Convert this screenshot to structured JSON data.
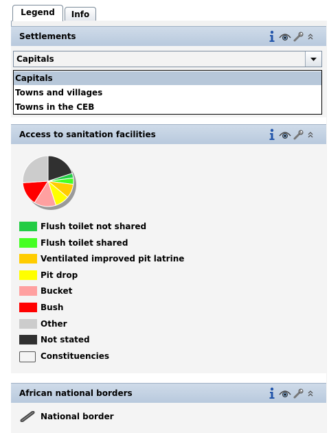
{
  "tabs": [
    {
      "label": "Legend"
    },
    {
      "label": "Info"
    }
  ],
  "settlements": {
    "title": "Settlements",
    "combo_value": "Capitals",
    "options": [
      "Capitals",
      "Towns and villages",
      "Towns in the CEB"
    ]
  },
  "sanitation": {
    "title": "Access to sanitation facilities",
    "pie_slices": [
      {
        "label": "Not stated",
        "value": 20,
        "color": "#303030"
      },
      {
        "label": "Flush toilet not shared",
        "value": 3,
        "color": "#22cc44"
      },
      {
        "label": "Flush toilet shared",
        "value": 4,
        "color": "#44ff22"
      },
      {
        "label": "Ventilated improved pit latrine",
        "value": 9,
        "color": "#ffcc00"
      },
      {
        "label": "Pit drop",
        "value": 9,
        "color": "#ffff00"
      },
      {
        "label": "Bucket",
        "value": 14,
        "color": "#ffa0a0"
      },
      {
        "label": "Bush",
        "value": 15,
        "color": "#ff0000"
      },
      {
        "label": "Other",
        "value": 26,
        "color": "#cccccc"
      }
    ],
    "legend": [
      {
        "label": "Flush toilet not shared",
        "color": "#22cc44"
      },
      {
        "label": "Flush toilet shared",
        "color": "#44ff22"
      },
      {
        "label": "Ventilated improved pit latrine",
        "color": "#ffcc00"
      },
      {
        "label": "Pit drop",
        "color": "#ffff00"
      },
      {
        "label": "Bucket",
        "color": "#ffa0a0"
      },
      {
        "label": "Bush",
        "color": "#ff0000"
      },
      {
        "label": "Other",
        "color": "#cccccc"
      },
      {
        "label": "Not stated",
        "color": "#303030"
      },
      {
        "label": "Constituencies",
        "color": "#f4f4f4"
      }
    ]
  },
  "borders": {
    "title": "African national borders",
    "legend_label": "National border"
  },
  "icons": [
    "info-icon",
    "visibility-eye-icon",
    "wrench-icon",
    "collapse-chevron-icon"
  ]
}
